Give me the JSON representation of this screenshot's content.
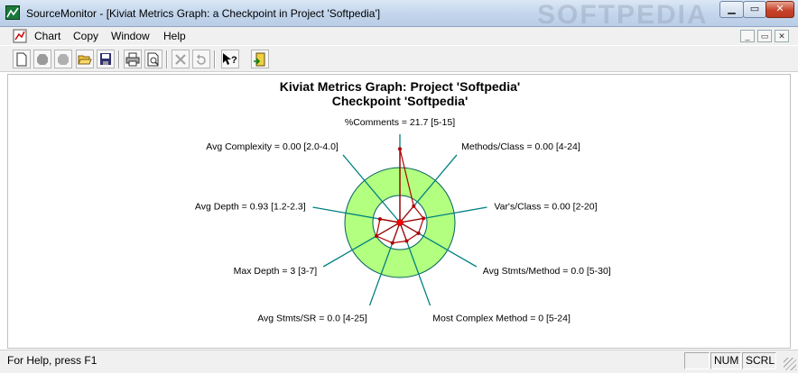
{
  "window": {
    "title": "SourceMonitor - [Kiviat Metrics Graph: a Checkpoint in Project 'Softpedia']",
    "watermark": "SOFTPEDIA",
    "min_glyph": "▁",
    "max_glyph": "▭",
    "close_glyph": "✕"
  },
  "menu": {
    "items": [
      "Chart",
      "Copy",
      "Window",
      "Help"
    ],
    "mdi_glyphs": [
      "_",
      "▭",
      "✕"
    ]
  },
  "toolbar": {
    "buttons": [
      "new-document",
      "stop",
      "stop-disabled",
      "open",
      "save",
      "print",
      "print-preview",
      "delete",
      "undo",
      "context-help",
      "exit"
    ]
  },
  "status": {
    "message": "For Help, press F1",
    "panels": [
      "",
      "NUM",
      "SCRL"
    ]
  },
  "colors": {
    "axis": "#008080",
    "band_fill": "#b3ff80",
    "band_stroke": "#006060",
    "data_line": "#b00000",
    "center": "#ff0000"
  },
  "chart_data": {
    "type": "radar",
    "title": "Kiviat Metrics Graph: Project 'Softpedia'",
    "subtitle": "Checkpoint 'Softpedia'",
    "axes": [
      {
        "label": "%Comments = 21.7 [5-15]",
        "metric": "%Comments",
        "value": 21.7,
        "range": [
          5,
          15
        ]
      },
      {
        "label": "Methods/Class = 0.00 [4-24]",
        "metric": "Methods/Class",
        "value": 0.0,
        "range": [
          4,
          24
        ]
      },
      {
        "label": "Var's/Class = 0.00 [2-20]",
        "metric": "Var's/Class",
        "value": 0.0,
        "range": [
          2,
          20
        ]
      },
      {
        "label": "Avg Stmts/Method = 0.0 [5-30]",
        "metric": "Avg Stmts/Method",
        "value": 0.0,
        "range": [
          5,
          30
        ]
      },
      {
        "label": "Most Complex Method = 0 [5-24]",
        "metric": "Most Complex Method",
        "value": 0,
        "range": [
          5,
          24
        ]
      },
      {
        "label": "Avg Stmts/SR = 0.0 [4-25]",
        "metric": "Avg Stmts/SR",
        "value": 0.0,
        "range": [
          4,
          25
        ]
      },
      {
        "label": "Max Depth = 3 [3-7]",
        "metric": "Max Depth",
        "value": 3,
        "range": [
          3,
          7
        ]
      },
      {
        "label": "Avg Depth = 0.93 [1.2-2.3]",
        "metric": "Avg Depth",
        "value": 0.93,
        "range": [
          1.2,
          2.3
        ]
      },
      {
        "label": "Avg Complexity = 0.00 [2.0-4.0]",
        "metric": "Avg Complexity",
        "value": 0.0,
        "range": [
          2.0,
          4.0
        ]
      }
    ]
  }
}
